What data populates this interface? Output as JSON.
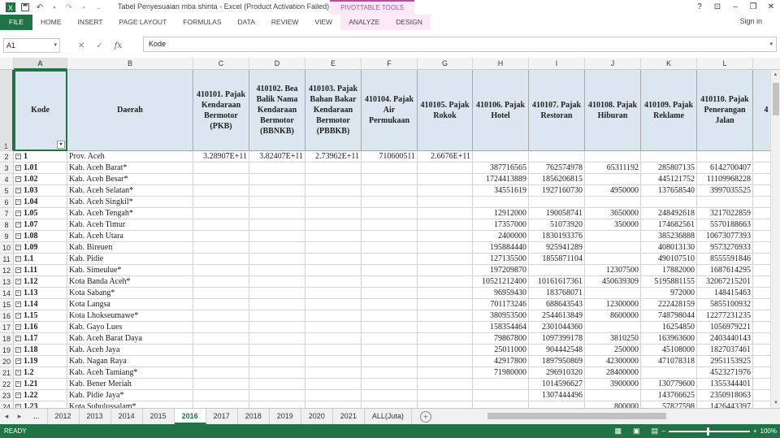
{
  "title_bar": {
    "doc_title": "Tabel Penyesuaian mba shinta - Excel (Product Activation Failed)",
    "context_tab": "PIVOTTABLE TOOLS",
    "help": "?",
    "min": "–",
    "restore": "❐",
    "close": "✕",
    "ribbon_display": "⊡"
  },
  "ribbon": {
    "tabs": [
      "FILE",
      "HOME",
      "INSERT",
      "PAGE LAYOUT",
      "FORMULAS",
      "DATA",
      "REVIEW",
      "VIEW",
      "ANALYZE",
      "DESIGN"
    ],
    "sign_in": "Sign in"
  },
  "formula_bar": {
    "name_box": "A1",
    "cancel": "✕",
    "enter": "✓",
    "fx": "fx",
    "content": "Kode"
  },
  "columns": [
    "A",
    "B",
    "C",
    "D",
    "E",
    "F",
    "G",
    "H",
    "I",
    "J",
    "K",
    "L"
  ],
  "header_row": [
    "Kode",
    "Daerah",
    "410101. Pajak Kendaraan Bermotor (PKB)",
    "410102. Bea Balik Nama Kendaraan Bermotor (BBNKB)",
    "410103. Pajak Bahan Bakar Kendaraan Bermotor (PBBKB)",
    "410104. Pajak Air Permukaan",
    "410105. Pajak Rokok",
    "410106. Pajak Hotel",
    "410107. Pajak Restoran",
    "410108. Pajak Hiburan",
    "410109. Pajak Reklame",
    "410110. Pajak Penerangan Jalan",
    "4",
    "Paj"
  ],
  "rows": [
    {
      "r": "2",
      "kode": "1",
      "daerah": "Prov. Aceh",
      "v": [
        "3.28907E+11",
        "3.82407E+11",
        "2.73962E+11",
        "710600511",
        "2.6676E+11",
        "",
        "",
        "",
        "",
        ""
      ]
    },
    {
      "r": "3",
      "kode": "1.01",
      "daerah": "Kab. Aceh Barat*",
      "v": [
        "",
        "",
        "",
        "",
        "",
        "387716565",
        "762574978",
        "65311192",
        "285807135",
        "6142700407"
      ]
    },
    {
      "r": "4",
      "kode": "1.02",
      "daerah": "Kab. Aceh Besar*",
      "v": [
        "",
        "",
        "",
        "",
        "",
        "1724413889",
        "1856206815",
        "",
        "445121752",
        "11109968228"
      ]
    },
    {
      "r": "5",
      "kode": "1.03",
      "daerah": "Kab. Aceh Selatan*",
      "v": [
        "",
        "",
        "",
        "",
        "",
        "34551619",
        "1927160730",
        "4950000",
        "137658540",
        "3997035525"
      ]
    },
    {
      "r": "6",
      "kode": "1.04",
      "daerah": "Kab. Aceh Singkil*",
      "v": [
        "",
        "",
        "",
        "",
        "",
        "",
        "",
        "",
        "",
        ""
      ]
    },
    {
      "r": "7",
      "kode": "1.05",
      "daerah": "Kab. Aceh Tengah*",
      "v": [
        "",
        "",
        "",
        "",
        "",
        "12912000",
        "190058741",
        "3650000",
        "248492618",
        "3217022859"
      ]
    },
    {
      "r": "8",
      "kode": "1.07",
      "daerah": "Kab. Aceh Timur",
      "v": [
        "",
        "",
        "",
        "",
        "",
        "17357000",
        "51073920",
        "350000",
        "174682561",
        "5570188663"
      ]
    },
    {
      "r": "9",
      "kode": "1.08",
      "daerah": "Kab. Aceh Utara",
      "v": [
        "",
        "",
        "",
        "",
        "",
        "2400000",
        "1830193376",
        "",
        "385236888",
        "10673077393"
      ]
    },
    {
      "r": "10",
      "kode": "1.09",
      "daerah": "Kab. Bireuen",
      "v": [
        "",
        "",
        "",
        "",
        "",
        "195884440",
        "925941289",
        "",
        "408013130",
        "9573276933"
      ]
    },
    {
      "r": "11",
      "kode": "1.1",
      "daerah": "Kab. Pidie",
      "v": [
        "",
        "",
        "",
        "",
        "",
        "127135500",
        "1855871104",
        "",
        "490107510",
        "8555591846"
      ]
    },
    {
      "r": "12",
      "kode": "1.11",
      "daerah": "Kab. Simeulue*",
      "v": [
        "",
        "",
        "",
        "",
        "",
        "197209870",
        "",
        "12307500",
        "17882000",
        "1687614295"
      ]
    },
    {
      "r": "13",
      "kode": "1.12",
      "daerah": "Kota Banda Aceh*",
      "v": [
        "",
        "",
        "",
        "",
        "",
        "10521212400",
        "10161617361",
        "450639309",
        "5195881155",
        "32067215201"
      ]
    },
    {
      "r": "14",
      "kode": "1.13",
      "daerah": "Kota Sabang*",
      "v": [
        "",
        "",
        "",
        "",
        "",
        "96959430",
        "183768071",
        "",
        "972000",
        "148415463"
      ]
    },
    {
      "r": "15",
      "kode": "1.14",
      "daerah": "Kota Langsa",
      "v": [
        "",
        "",
        "",
        "",
        "",
        "701173246",
        "688643543",
        "12300000",
        "222428159",
        "5855100932"
      ]
    },
    {
      "r": "16",
      "kode": "1.15",
      "daerah": "Kota Lhokseumawe*",
      "v": [
        "",
        "",
        "",
        "",
        "",
        "380953500",
        "2544613849",
        "8600000",
        "748798044",
        "12277231235"
      ]
    },
    {
      "r": "17",
      "kode": "1.16",
      "daerah": "Kab. Gayo Lues",
      "v": [
        "",
        "",
        "",
        "",
        "",
        "158354464",
        "2301044360",
        "",
        "16254850",
        "1056979221"
      ]
    },
    {
      "r": "18",
      "kode": "1.17",
      "daerah": "Kab. Aceh Barat Daya",
      "v": [
        "",
        "",
        "",
        "",
        "",
        "79867800",
        "1097399178",
        "3810250",
        "163963600",
        "2403440143"
      ]
    },
    {
      "r": "19",
      "kode": "1.18",
      "daerah": "Kab. Aceh Jaya",
      "v": [
        "",
        "",
        "",
        "",
        "",
        "25011000",
        "904442548",
        "250000",
        "45108000",
        "1827037461"
      ]
    },
    {
      "r": "20",
      "kode": "1.19",
      "daerah": "Kab. Nagan Raya",
      "v": [
        "",
        "",
        "",
        "",
        "",
        "42917800",
        "1897950869",
        "42300000",
        "471078318",
        "2951153925"
      ]
    },
    {
      "r": "21",
      "kode": "1.2",
      "daerah": "Kab. Aceh Tamiang*",
      "v": [
        "",
        "",
        "",
        "",
        "",
        "71980000",
        "296910320",
        "28400000",
        "",
        "4523271976"
      ]
    },
    {
      "r": "22",
      "kode": "1.21",
      "daerah": "Kab. Bener Meriah",
      "v": [
        "",
        "",
        "",
        "",
        "",
        "",
        "1014596627",
        "3900000",
        "130779600",
        "1355344401"
      ]
    },
    {
      "r": "23",
      "kode": "1.22",
      "daerah": "Kab. Pidie Jaya*",
      "v": [
        "",
        "",
        "",
        "",
        "",
        "",
        "1307444496",
        "",
        "143766625",
        "2350918063"
      ]
    },
    {
      "r": "24",
      "kode": "1.23",
      "daerah": "Kota Subulussalam*",
      "v": [
        "",
        "",
        "",
        "",
        "",
        "",
        "",
        "800000",
        "57827598",
        "1426443397"
      ]
    }
  ],
  "sheet_tabs": [
    "2012",
    "2013",
    "2014",
    "2015",
    "2016",
    "2017",
    "2018",
    "2019",
    "2020",
    "2021",
    "ALL(Juta)"
  ],
  "active_sheet": "2016",
  "nav": {
    "prev": "◂",
    "next": "▸",
    "more": "..."
  },
  "status": {
    "ready": "READY",
    "zoom": "100%",
    "minus": "−",
    "plus": "+"
  },
  "accent": "#217346"
}
